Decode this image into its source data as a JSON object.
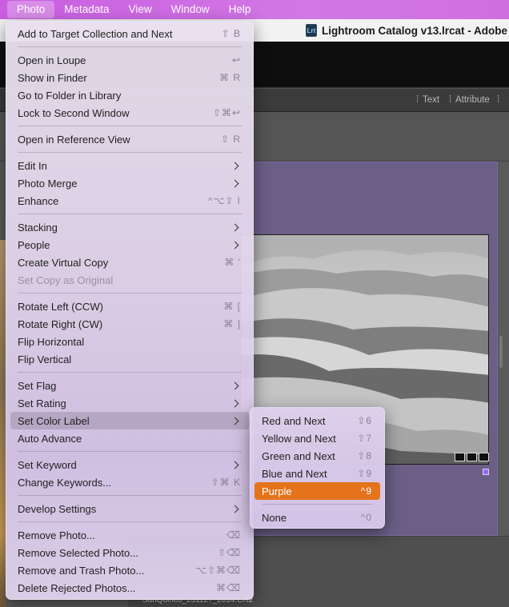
{
  "menubar": {
    "items": [
      "Photo",
      "Metadata",
      "View",
      "Window",
      "Help"
    ],
    "active": "Photo"
  },
  "window": {
    "icon_text": "Lrt",
    "title": "Lightroom Catalog v13.lrcat - Adobe"
  },
  "filterbar": {
    "items": [
      "Text",
      "Attribute"
    ]
  },
  "grid": {
    "filename": "SanQuirico_23112?_2614.CR2"
  },
  "photo_menu": {
    "items": [
      {
        "label": "Add to Target Collection and Next",
        "shortcut": "⇧ B"
      },
      {
        "label": "Open in Loupe",
        "shortcut": "↩"
      },
      {
        "label": "Show in Finder",
        "shortcut": "⌘ R"
      },
      {
        "label": "Go to Folder in Library",
        "shortcut": ""
      },
      {
        "label": "Lock to Second Window",
        "shortcut": "⇧⌘↩"
      },
      {
        "label": "Open in Reference View",
        "shortcut": "⇧ R"
      },
      {
        "label": "Edit In",
        "shortcut": ""
      },
      {
        "label": "Photo Merge",
        "shortcut": ""
      },
      {
        "label": "Enhance",
        "shortcut": "^⌥⇧ I"
      },
      {
        "label": "Stacking",
        "shortcut": ""
      },
      {
        "label": "People",
        "shortcut": ""
      },
      {
        "label": "Create Virtual Copy",
        "shortcut": "⌘ '"
      },
      {
        "label": "Set Copy as Original",
        "shortcut": ""
      },
      {
        "label": "Rotate Left (CCW)",
        "shortcut": "⌘ ["
      },
      {
        "label": "Rotate Right (CW)",
        "shortcut": "⌘ ]"
      },
      {
        "label": "Flip Horizontal",
        "shortcut": ""
      },
      {
        "label": "Flip Vertical",
        "shortcut": ""
      },
      {
        "label": "Set Flag",
        "shortcut": ""
      },
      {
        "label": "Set Rating",
        "shortcut": ""
      },
      {
        "label": "Set Color Label",
        "shortcut": ""
      },
      {
        "label": "Auto Advance",
        "shortcut": ""
      },
      {
        "label": "Set Keyword",
        "shortcut": ""
      },
      {
        "label": "Change Keywords...",
        "shortcut": "⇧⌘ K"
      },
      {
        "label": "Develop Settings",
        "shortcut": ""
      },
      {
        "label": "Remove Photo...",
        "shortcut": "⌫"
      },
      {
        "label": "Remove Selected Photo...",
        "shortcut": "⇧⌫"
      },
      {
        "label": "Remove and Trash Photo...",
        "shortcut": "⌥⇧⌘⌫"
      },
      {
        "label": "Delete Rejected Photos...",
        "shortcut": "⌘⌫"
      }
    ]
  },
  "color_label_submenu": {
    "items": [
      {
        "label": "Red and Next",
        "shortcut": "⇧6"
      },
      {
        "label": "Yellow and Next",
        "shortcut": "⇧7"
      },
      {
        "label": "Green and Next",
        "shortcut": "⇧8"
      },
      {
        "label": "Blue and Next",
        "shortcut": "⇧9"
      },
      {
        "label": "Purple",
        "shortcut": "^9"
      },
      {
        "label": "None",
        "shortcut": "^0"
      }
    ]
  },
  "colors": {
    "menubar_accent": "#c95ee0",
    "highlight_orange": "#e4731b",
    "purple_label": "#6b5f87"
  }
}
